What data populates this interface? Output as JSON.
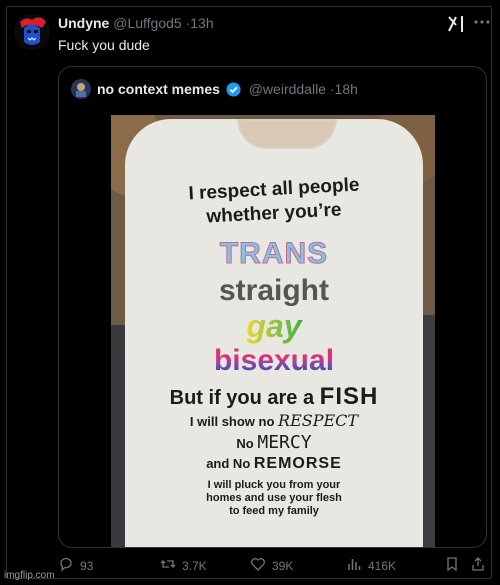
{
  "tweet": {
    "author_name": "Undyne",
    "author_handle": "@Luffgod5",
    "separator": "·",
    "time": "13h",
    "text": "Fuck you dude"
  },
  "quote": {
    "author_name": "no context memes",
    "author_handle": "@weirddalle",
    "separator": "·",
    "time": "18h",
    "verified_color": "#1d9bf0",
    "shirt_text": {
      "line1": "I respect all people",
      "line2": "whether you’re",
      "trans": "TRANS",
      "straight": "straight",
      "gay": "gay",
      "bisexual": "bisexual",
      "fish_prefix": "But if you are a ",
      "fish_word": "FISH",
      "respect_prefix": "I will show no ",
      "respect_word": "RESPECT",
      "mercy_prefix": "No ",
      "mercy_word": "MERCY",
      "remorse_prefix": "and No ",
      "remorse_word": "REMORSE",
      "pluck_1": "I will pluck you from your",
      "pluck_2": "homes and use your flesh",
      "pluck_3": "to feed my family"
    }
  },
  "actions": {
    "replies": "93",
    "reposts": "3.7K",
    "likes": "39K",
    "views": "416K"
  },
  "icons": {
    "more": "more-icon",
    "grok": "grok-icon",
    "reply": "reply-icon",
    "repost": "repost-icon",
    "like": "heart-icon",
    "views": "views-icon",
    "bookmark": "bookmark-icon",
    "share": "share-icon"
  },
  "watermark": "imgflip.com",
  "colors": {
    "background": "#000000",
    "text": "#e7e9ea",
    "muted": "#71767b",
    "border": "#2f3336"
  }
}
